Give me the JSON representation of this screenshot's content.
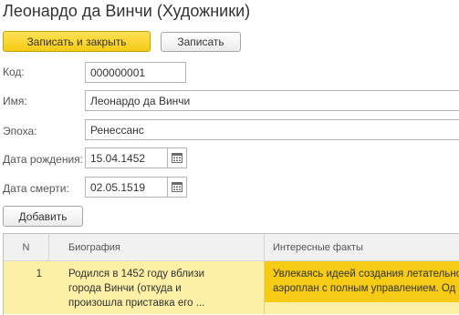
{
  "header": {
    "title": "Леонардо да Винчи (Художники)"
  },
  "toolbar": {
    "save_close_label": "Записать и закрыть",
    "save_label": "Записать"
  },
  "form": {
    "code": {
      "label": "Код:",
      "value": "000000001"
    },
    "name": {
      "label": "Имя:",
      "value": "Леонардо да Винчи"
    },
    "epoch": {
      "label": "Эпоха:",
      "value": "Ренессанс"
    },
    "birth_date": {
      "label": "Дата рождения:",
      "value": "15.04.1452"
    },
    "death_date": {
      "label": "Дата смерти:",
      "value": "02.05.1519"
    }
  },
  "table": {
    "add_label": "Добавить",
    "columns": [
      "N",
      "Биография",
      "Интересные факты"
    ],
    "rows": [
      {
        "n": "1",
        "biography": [
          "Родился в 1452 году вблизи",
          "города Винчи (откуда и",
          "произошла приставка его ..."
        ],
        "facts": [
          "Увлекаясь идеей создания летательно",
          "аэроплан с полным управлением. Од"
        ]
      }
    ]
  },
  "icons": {
    "calendar": "calendar-icon"
  },
  "colors": {
    "primary_button": "#f6cb16",
    "selected_row": "#fbf0a6",
    "selected_cell": "#f6cb16"
  }
}
